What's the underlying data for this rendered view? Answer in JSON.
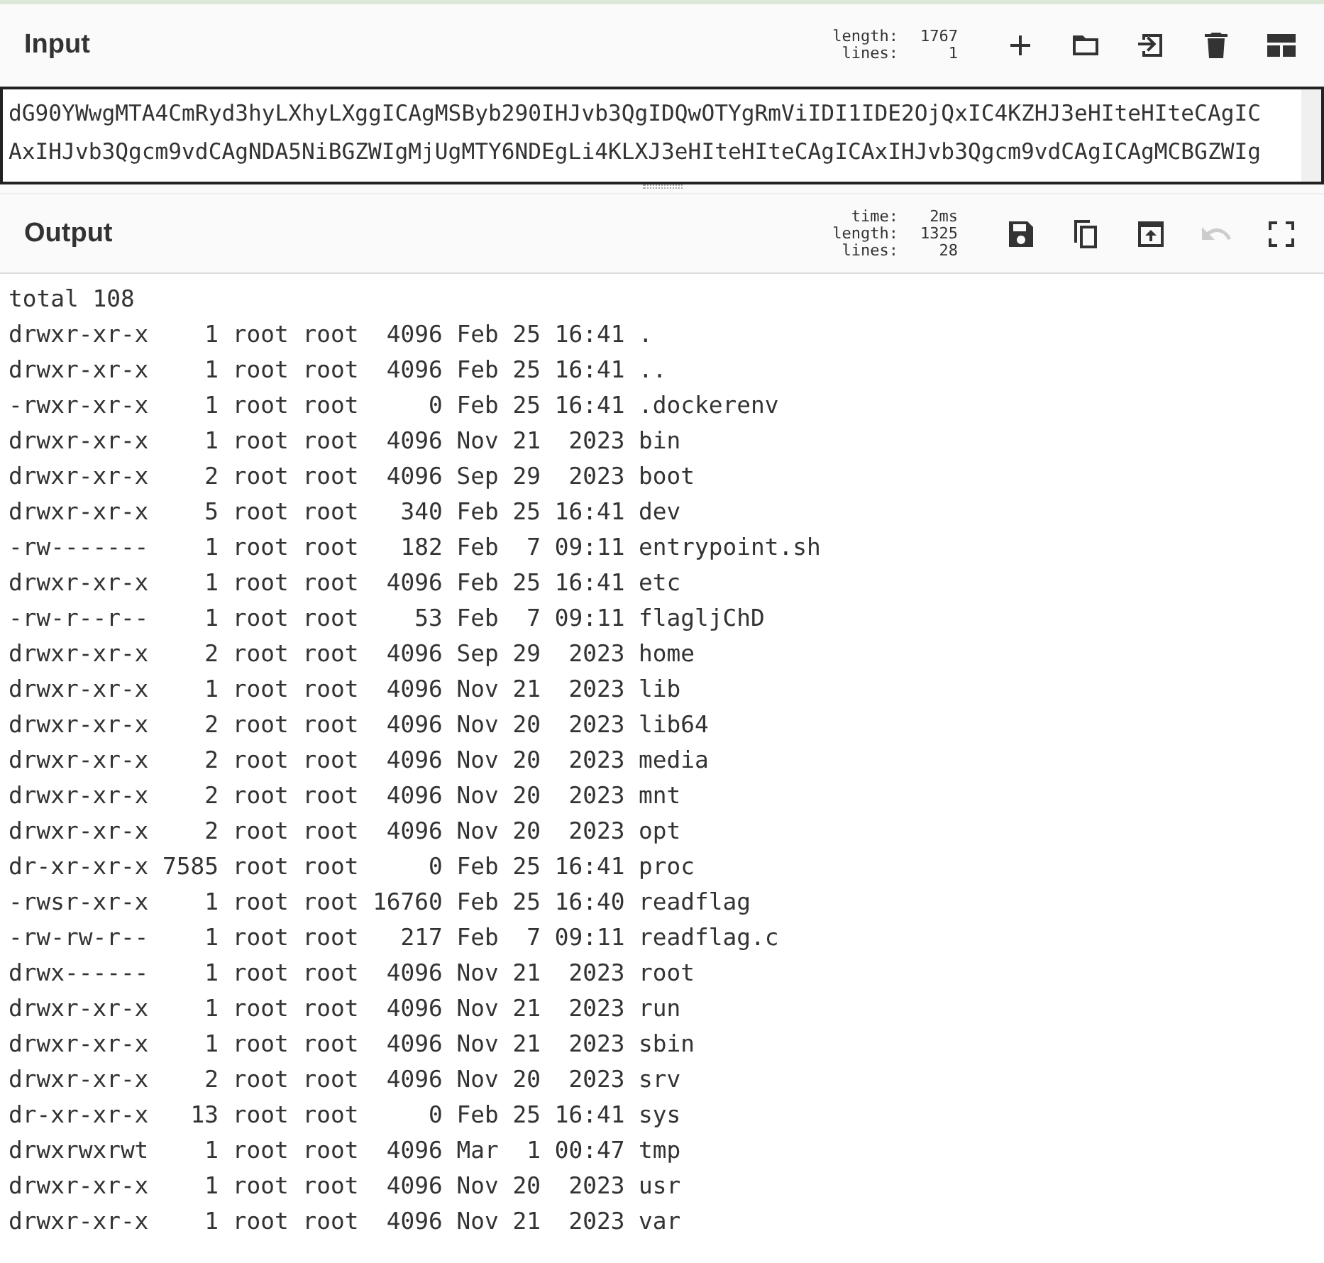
{
  "input": {
    "title": "Input",
    "stats": [
      {
        "label": "length:",
        "value": "1767"
      },
      {
        "label": "lines:",
        "value": "1"
      }
    ],
    "buttons": [
      {
        "kind": "add",
        "disabled": false
      },
      {
        "kind": "folder",
        "disabled": false
      },
      {
        "kind": "import",
        "disabled": false
      },
      {
        "kind": "delete",
        "disabled": false
      },
      {
        "kind": "layout",
        "disabled": false
      }
    ],
    "lines": [
      "dG90YWwgMTA4CmRyd3hyLXhyLXggICAgMSByb290IHJvb3QgIDQwOTYgRmViIDI1IDE2OjQxIC4KZHJ3eHIteHIteCAgIC",
      "AxIHJvb3Qgcm9vdCAgNDA5NiBGZWIgMjUgMTY6NDEgLi4KLXJ3eHIteHIteCAgICAxIHJvb3Qgcm9vdCAgICAgMCBGZWIg"
    ]
  },
  "output": {
    "title": "Output",
    "stats": [
      {
        "label": "time:",
        "value": "2ms"
      },
      {
        "label": "length:",
        "value": "1325"
      },
      {
        "label": "lines:",
        "value": "28"
      }
    ],
    "buttons": [
      {
        "kind": "save",
        "disabled": false
      },
      {
        "kind": "copy",
        "disabled": false
      },
      {
        "kind": "replace",
        "disabled": false
      },
      {
        "kind": "undo",
        "disabled": true
      },
      {
        "kind": "fullscreen",
        "disabled": false
      }
    ],
    "lines": [
      "total 108",
      "drwxr-xr-x    1 root root  4096 Feb 25 16:41 .",
      "drwxr-xr-x    1 root root  4096 Feb 25 16:41 ..",
      "-rwxr-xr-x    1 root root     0 Feb 25 16:41 .dockerenv",
      "drwxr-xr-x    1 root root  4096 Nov 21  2023 bin",
      "drwxr-xr-x    2 root root  4096 Sep 29  2023 boot",
      "drwxr-xr-x    5 root root   340 Feb 25 16:41 dev",
      "-rw-------    1 root root   182 Feb  7 09:11 entrypoint.sh",
      "drwxr-xr-x    1 root root  4096 Feb 25 16:41 etc",
      "-rw-r--r--    1 root root    53 Feb  7 09:11 flagljChD",
      "drwxr-xr-x    2 root root  4096 Sep 29  2023 home",
      "drwxr-xr-x    1 root root  4096 Nov 21  2023 lib",
      "drwxr-xr-x    2 root root  4096 Nov 20  2023 lib64",
      "drwxr-xr-x    2 root root  4096 Nov 20  2023 media",
      "drwxr-xr-x    2 root root  4096 Nov 20  2023 mnt",
      "drwxr-xr-x    2 root root  4096 Nov 20  2023 opt",
      "dr-xr-xr-x 7585 root root     0 Feb 25 16:41 proc",
      "-rwsr-xr-x    1 root root 16760 Feb 25 16:40 readflag",
      "-rw-rw-r--    1 root root   217 Feb  7 09:11 readflag.c",
      "drwx------    1 root root  4096 Nov 21  2023 root",
      "drwxr-xr-x    1 root root  4096 Nov 21  2023 run",
      "drwxr-xr-x    1 root root  4096 Nov 21  2023 sbin",
      "drwxr-xr-x    2 root root  4096 Nov 20  2023 srv",
      "dr-xr-xr-x   13 root root     0 Feb 25 16:41 sys",
      "drwxrwxrwt    1 root root  4096 Mar  1 00:47 tmp",
      "drwxr-xr-x    1 root root  4096 Nov 20  2023 usr",
      "drwxr-xr-x    1 root root  4096 Nov 21  2023 var"
    ]
  }
}
